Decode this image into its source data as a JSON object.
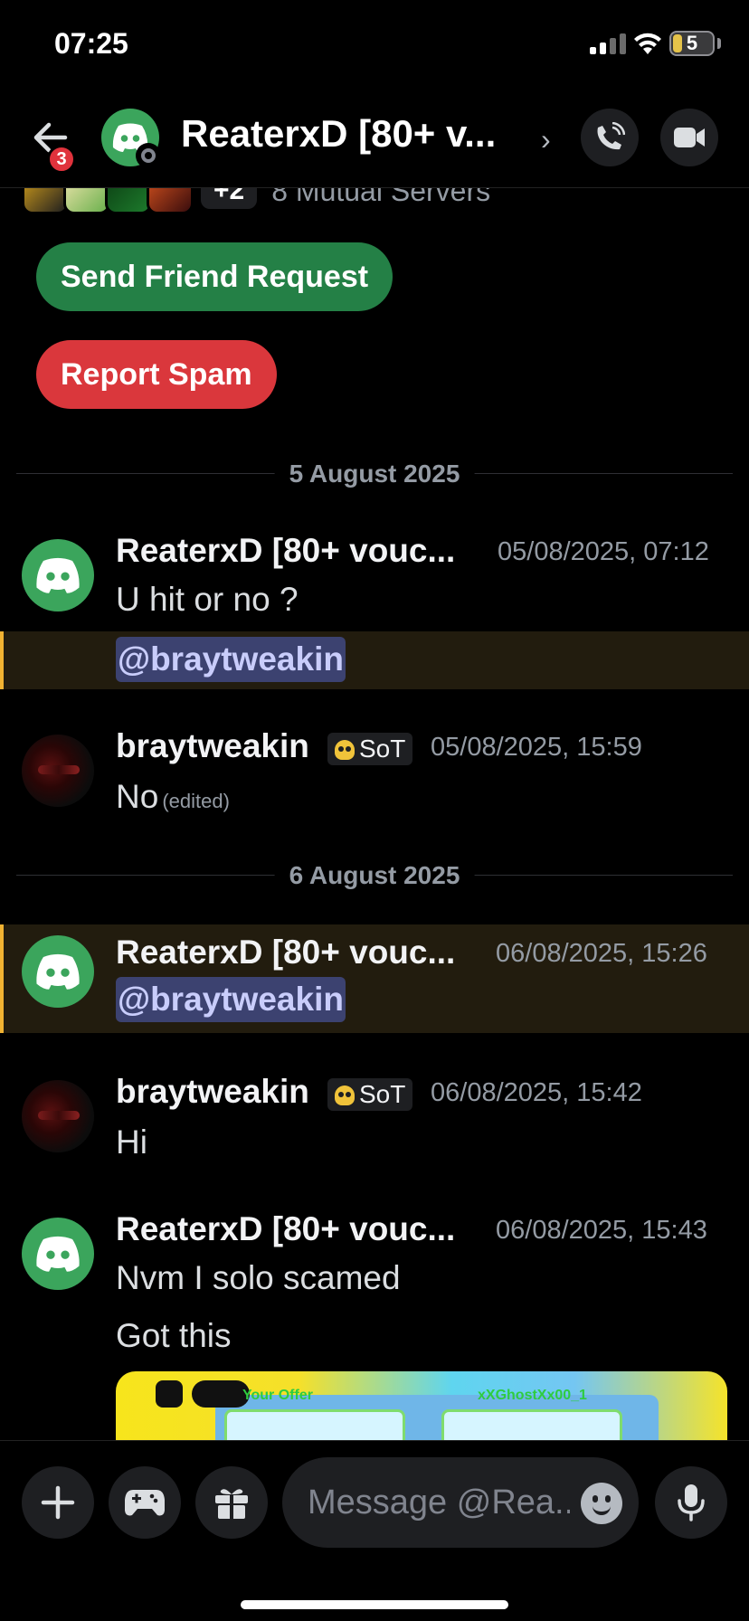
{
  "status_bar": {
    "time": "07:25",
    "battery": "5"
  },
  "header": {
    "title": "ReaterxD [80+ v...",
    "unread_count": "3"
  },
  "profile": {
    "mutual_extra": "+2",
    "mutual_servers": "8 Mutual Servers",
    "send_friend_request": "Send Friend Request",
    "report_spam": "Report Spam"
  },
  "dividers": [
    "5 August 2025",
    "6 August 2025"
  ],
  "messages": [
    {
      "author": "ReaterxD [80+ vouc...",
      "timestamp": "05/08/2025, 07:12",
      "lines": [
        "U hit or no ?"
      ],
      "mention": "@braytweakin"
    },
    {
      "author": "braytweakin",
      "tag": "SoT",
      "timestamp": "05/08/2025, 15:59",
      "lines": [
        "No"
      ],
      "edited": "(edited)"
    },
    {
      "author": "ReaterxD [80+ vouc...",
      "timestamp": "06/08/2025, 15:26",
      "mention": "@braytweakin"
    },
    {
      "author": "braytweakin",
      "tag": "SoT",
      "timestamp": "06/08/2025, 15:42",
      "lines": [
        "Hi"
      ]
    },
    {
      "author": "ReaterxD [80+ vouc...",
      "timestamp": "06/08/2025, 15:43",
      "lines": [
        "Nvm I solo scamed",
        "Got this"
      ]
    }
  ],
  "attachment": {
    "left_label": "Your Offer",
    "right_label": "xXGhostXx00_1"
  },
  "composer": {
    "placeholder": "Message @Rea.."
  },
  "colors": {
    "green": "#248046",
    "red": "#da373c",
    "mention_bg": "#221c0e",
    "mention_bar": "#f0b232",
    "discord_green": "#3ba55c"
  }
}
